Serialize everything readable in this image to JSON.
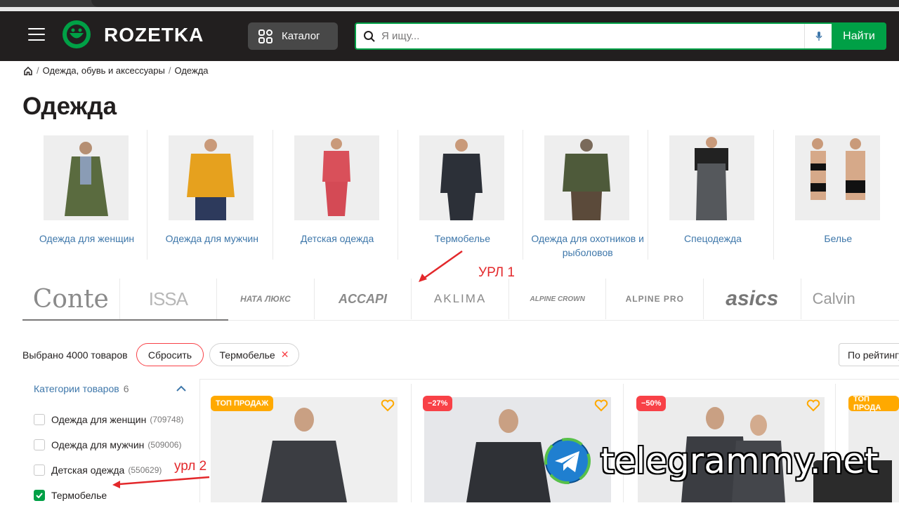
{
  "header": {
    "logo": "ROZETKA",
    "catalog_label": "Каталог",
    "search_placeholder": "Я ищу...",
    "search_button": "Найти"
  },
  "breadcrumb": {
    "items": [
      "Одежда, обувь и аксессуары",
      "Одежда"
    ],
    "separator": "/"
  },
  "page_title": "Одежда",
  "categories": [
    {
      "label": "Одежда для женщин"
    },
    {
      "label": "Одежда для мужчин"
    },
    {
      "label": "Детская одежда"
    },
    {
      "label": "Термобелье"
    },
    {
      "label": "Одежда для охотников и рыболовов"
    },
    {
      "label": "Спецодежда"
    },
    {
      "label": "Белье"
    }
  ],
  "brands": [
    "Conte",
    "ISSA",
    "НАТА ЛЮКС",
    "ACCAPI",
    "AKLIMA",
    "ALPINE CROWN",
    "ALPINE PRO",
    "asics",
    "Calvin"
  ],
  "filters_bar": {
    "selected_text": "Выбрано 4000 товаров",
    "reset_label": "Сбросить",
    "chip_label": "Термобелье",
    "sort_label": "По рейтингу"
  },
  "sidebar": {
    "title": "Категории товаров",
    "count": "6",
    "items": [
      {
        "label": "Одежда для женщин",
        "count": "(709748)",
        "checked": false
      },
      {
        "label": "Одежда для мужчин",
        "count": "(509006)",
        "checked": false
      },
      {
        "label": "Детская одежда",
        "count": "(550629)",
        "checked": false
      },
      {
        "label": "Термобелье",
        "count": "",
        "checked": true
      }
    ]
  },
  "products": [
    {
      "badge": "ТОП ПРОДАЖ",
      "badge_type": "top"
    },
    {
      "badge": "−27%",
      "badge_type": "sale"
    },
    {
      "badge": "−50%",
      "badge_type": "sale"
    },
    {
      "badge": "ТОП ПРОДА",
      "badge_type": "top"
    }
  ],
  "annotations": {
    "url1": "УРЛ 1",
    "url2": "урл 2"
  },
  "watermark": "telegrammy.net",
  "colors": {
    "accent": "#00a046",
    "link": "#3e77aa",
    "sale": "#f84147",
    "top": "#ffa900",
    "annotation": "#e3282b"
  }
}
